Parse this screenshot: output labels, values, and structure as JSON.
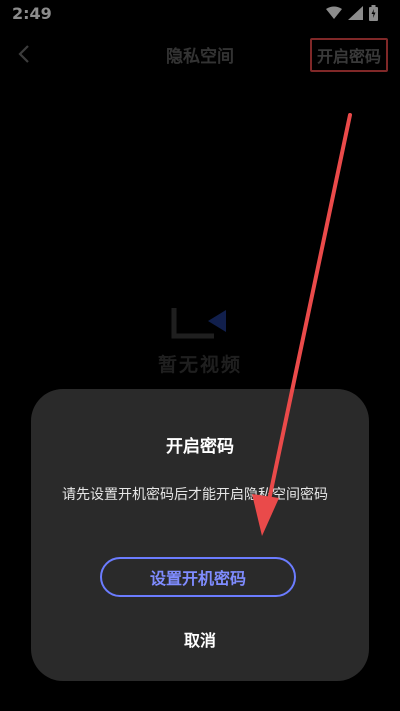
{
  "status_bar": {
    "time": "2:49"
  },
  "app_bar": {
    "back_icon": "chevron-left-icon",
    "title": "隐私空间",
    "open_password_label": "开启密码"
  },
  "empty_state": {
    "text": "暂无视频"
  },
  "dialog": {
    "title": "开启密码",
    "message": "请先设置开机密码后才能开启隐私空间密码",
    "primary_button": "设置开机密码",
    "cancel_button": "取消"
  },
  "colors": {
    "background": "#000000",
    "dialog_bg": "#2a2a2a",
    "accent": "#6b7cff",
    "annotation": "#ea4a4a"
  }
}
